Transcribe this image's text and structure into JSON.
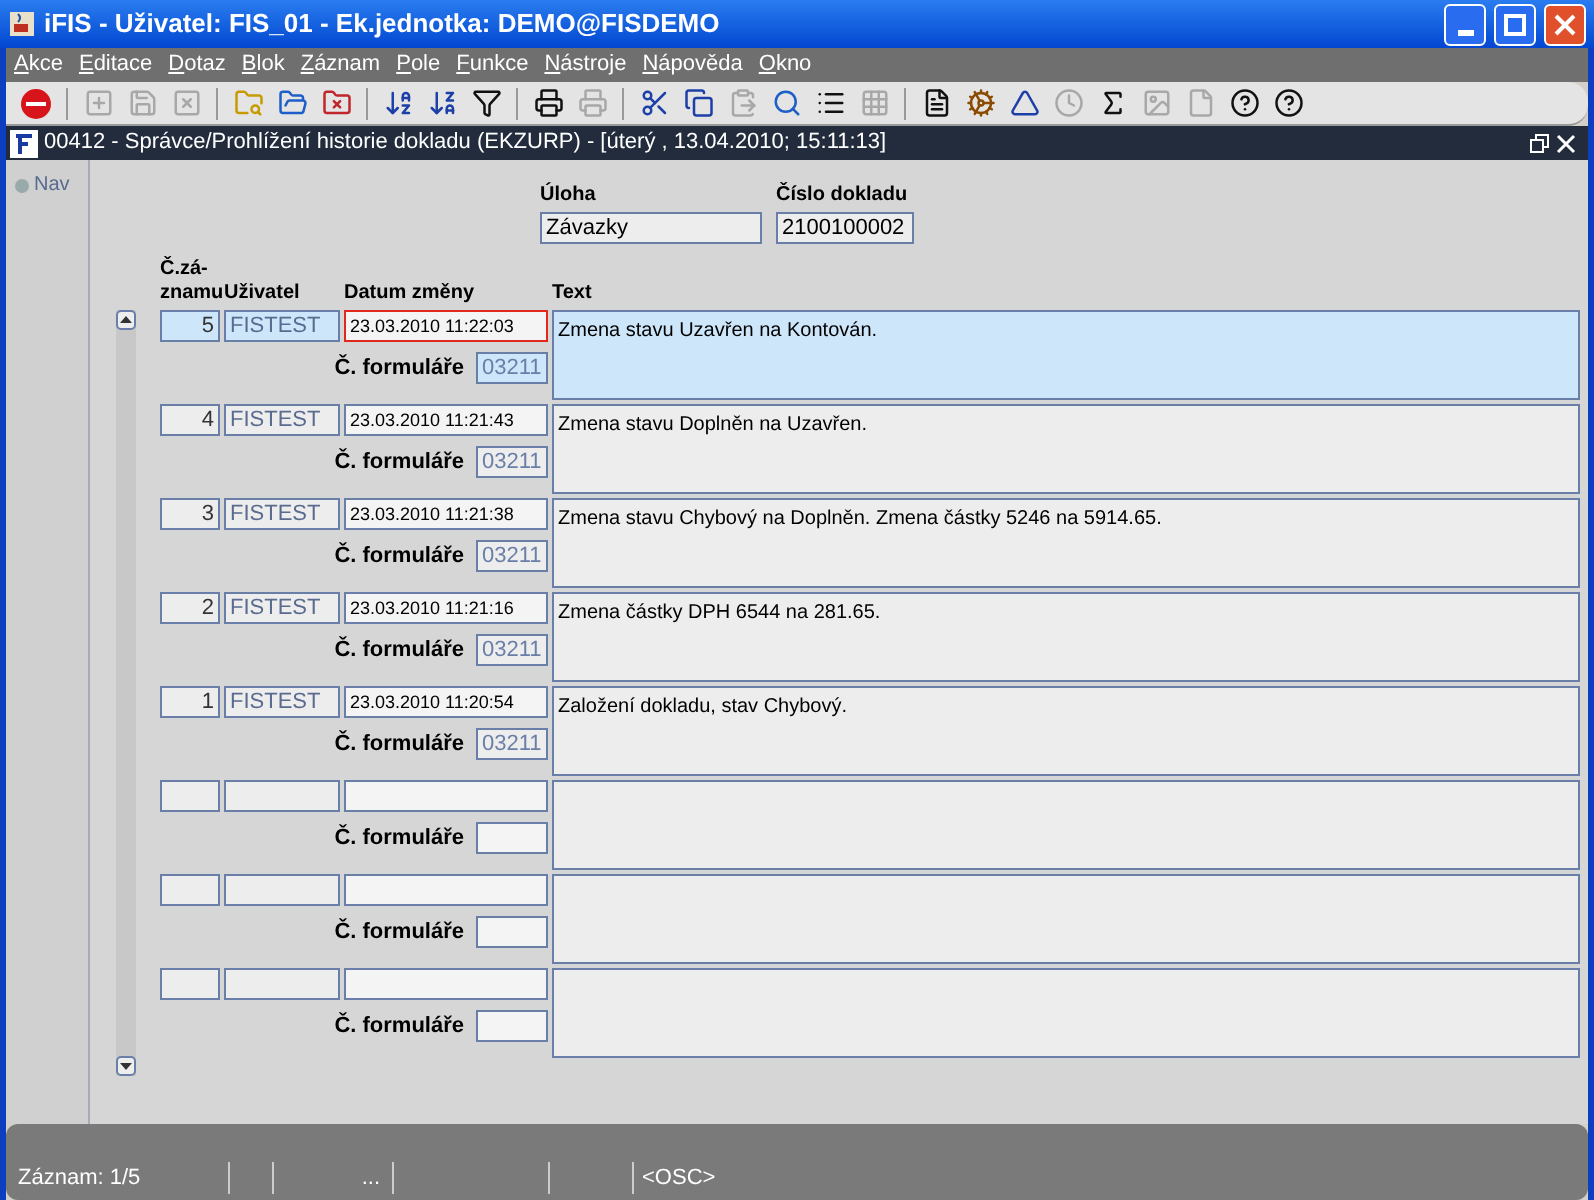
{
  "window": {
    "title": "iFIS - Uživatel: FIS_01 - Ek.jednotka: DEMO@FISDEMO"
  },
  "menu": [
    "Akce",
    "Editace",
    "Dotaz",
    "Blok",
    "Záznam",
    "Pole",
    "Funkce",
    "Nástroje",
    "Nápověda",
    "Okno"
  ],
  "toolbar": [
    {
      "kind": "exit",
      "disabled": false
    },
    {
      "kind": "sep"
    },
    {
      "kind": "newrow",
      "disabled": true
    },
    {
      "kind": "saverow",
      "disabled": true
    },
    {
      "kind": "delrow",
      "disabled": true
    },
    {
      "kind": "sep"
    },
    {
      "kind": "query",
      "disabled": false
    },
    {
      "kind": "run",
      "disabled": false
    },
    {
      "kind": "cancel",
      "disabled": false
    },
    {
      "kind": "sep"
    },
    {
      "kind": "sortup",
      "disabled": false
    },
    {
      "kind": "sortdown",
      "disabled": false
    },
    {
      "kind": "filter",
      "disabled": false
    },
    {
      "kind": "sep"
    },
    {
      "kind": "print",
      "disabled": false
    },
    {
      "kind": "print",
      "disabled": true
    },
    {
      "kind": "sep"
    },
    {
      "kind": "cut",
      "disabled": false
    },
    {
      "kind": "copy",
      "disabled": false
    },
    {
      "kind": "paste",
      "disabled": true
    },
    {
      "kind": "find",
      "disabled": false
    },
    {
      "kind": "list",
      "disabled": false
    },
    {
      "kind": "grid",
      "disabled": true
    },
    {
      "kind": "sep"
    },
    {
      "kind": "doc",
      "disabled": false
    },
    {
      "kind": "gear",
      "disabled": false
    },
    {
      "kind": "triangle",
      "disabled": false
    },
    {
      "kind": "clock",
      "disabled": true
    },
    {
      "kind": "sigma",
      "disabled": false
    },
    {
      "kind": "image",
      "disabled": true
    },
    {
      "kind": "page",
      "disabled": true
    },
    {
      "kind": "help",
      "disabled": false
    },
    {
      "kind": "help",
      "disabled": false
    }
  ],
  "form_window": {
    "title": "00412 - Správce/Prohlížení historie dokladu (EKZURP) - [úterý  , 13.04.2010; 15:11:13]"
  },
  "nav": {
    "label": "Nav"
  },
  "header": {
    "task_label": "Úloha",
    "task_value": "Závazky",
    "doc_label": "Číslo dokladu",
    "doc_value": "2100100002"
  },
  "columns": [
    "Č.zá-\nznamu",
    "Uživatel",
    "Datum změny",
    "Text"
  ],
  "records": [
    {
      "kind": "filled",
      "selected": true,
      "number": "5",
      "user": "FISTEST",
      "date": "23.03.2010 11:22:03",
      "form_label": "Č. formuláře",
      "form": "03211",
      "text": "Zmena stavu Uzavřen na Kontován."
    },
    {
      "kind": "filled",
      "selected": false,
      "number": "4",
      "user": "FISTEST",
      "date": "23.03.2010 11:21:43",
      "form_label": "Č. formuláře",
      "form": "03211",
      "text": "Zmena stavu Doplněn na Uzavřen."
    },
    {
      "kind": "filled",
      "selected": false,
      "number": "3",
      "user": "FISTEST",
      "date": "23.03.2010 11:21:38",
      "form_label": "Č. formuláře",
      "form": "03211",
      "text": "Zmena stavu Chybový na Doplněn. Zmena částky 5246 na 5914.65."
    },
    {
      "kind": "filled",
      "selected": false,
      "number": "2",
      "user": "FISTEST",
      "date": "23.03.2010 11:21:16",
      "form_label": "Č. formuláře",
      "form": "03211",
      "text": "Zmena částky DPH 6544 na 281.65."
    },
    {
      "kind": "filled",
      "selected": false,
      "number": "1",
      "user": "FISTEST",
      "date": "23.03.2010 11:20:54",
      "form_label": "Č. formuláře",
      "form": "03211",
      "text": "Založení dokladu, stav Chybový."
    },
    {
      "kind": "empty",
      "selected": false,
      "form_label": "Č. formuláře"
    },
    {
      "kind": "empty",
      "selected": false,
      "form_label": "Č. formuláře"
    },
    {
      "kind": "empty",
      "selected": false,
      "form_label": "Č. formuláře"
    }
  ],
  "status_bar": {
    "record": "Záznam: 1/5",
    "ellipsis": "...",
    "mode": "<OSC>"
  }
}
